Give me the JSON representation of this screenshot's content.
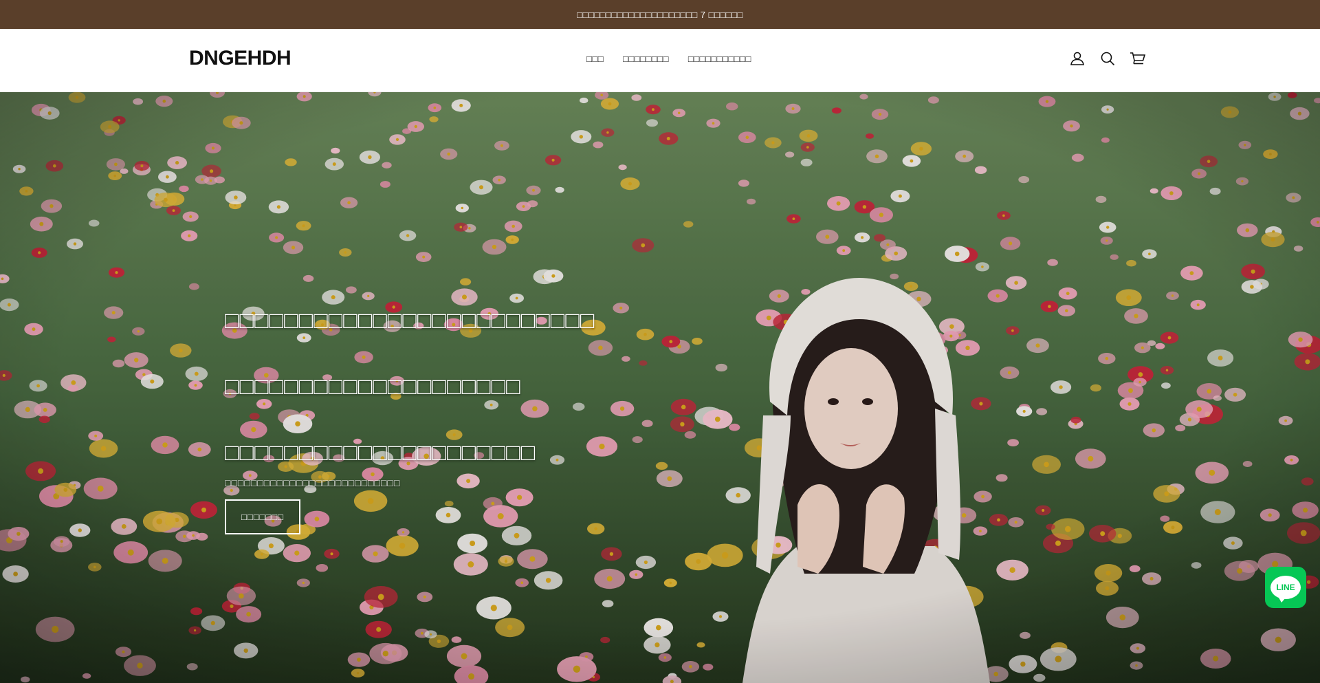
{
  "announcement": {
    "text": "□□□□□□□□□□□□□□□□□□□□□ 7 □□□□□□"
  },
  "header": {
    "logo": "DNGEHDH",
    "nav": [
      {
        "label": "□□□"
      },
      {
        "label": "□□□□□□□□"
      },
      {
        "label": "□□□□□□□□□□□"
      }
    ],
    "icons": [
      "account-icon",
      "search-icon",
      "cart-icon"
    ]
  },
  "hero": {
    "lines": [
      "□□□□□□□□□□□□□□□□□□□□□□□□□",
      "□□□□□□□□□□□□□□□□□□□□",
      "□□□□□□□□□□□□□□□□□□□□□"
    ],
    "subtitle": "□□□□□□□□□□□□□□□□□□□□□□□□□□□",
    "cta": "□□□□□□□",
    "colors": {
      "grass": "#3e5a38",
      "flower_pink": "#f2a7bd",
      "flower_red": "#c8283c",
      "flower_white": "#f4f0ee"
    }
  },
  "colors": {
    "announcement_bg": "#5a3f2a",
    "line_green": "#06c755"
  },
  "line_widget": {
    "label": "LINE"
  }
}
